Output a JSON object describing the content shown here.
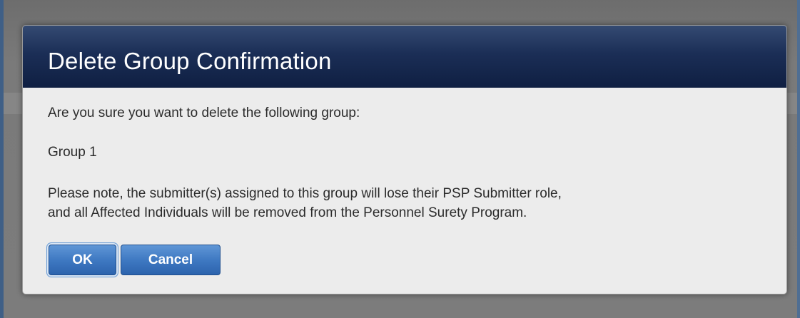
{
  "dialog": {
    "title": "Delete Group Confirmation",
    "question": "Are you sure you want to delete the following group:",
    "group_name": "Group 1",
    "note_line1": "Please note, the submitter(s) assigned to this group will lose their PSP Submitter role,",
    "note_line2": "and all Affected Individuals will be removed from the Personnel Surety Program.",
    "ok_label": "OK",
    "cancel_label": "Cancel"
  },
  "colors": {
    "header_dark": "#0f1f42",
    "header_light": "#344a72",
    "button_blue": "#3f79c2",
    "dialog_background": "#ececec",
    "overlay": "#7b7b7b"
  }
}
